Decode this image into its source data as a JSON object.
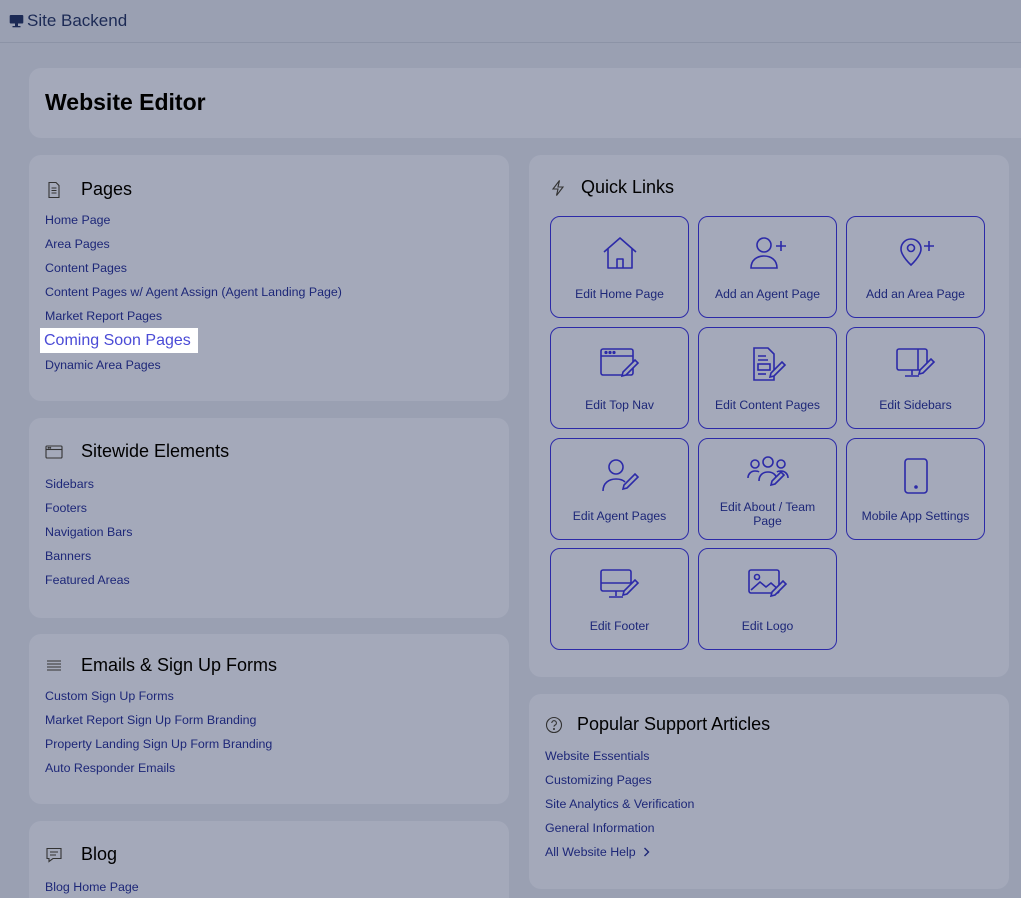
{
  "header": {
    "title": "Site Backend",
    "icon": "monitor-icon"
  },
  "editor": {
    "title": "Website Editor"
  },
  "pages": {
    "title": "Pages",
    "icon": "document-icon",
    "links": [
      "Home Page",
      "Area Pages",
      "Content Pages",
      "Content Pages w/ Agent Assign (Agent Landing Page)",
      "Market Report Pages",
      "Coming Soon Pages",
      "Dynamic Area Pages"
    ]
  },
  "sitewide": {
    "title": "Sitewide Elements",
    "icon": "browser-window-icon",
    "links": [
      "Sidebars",
      "Footers",
      "Navigation Bars",
      "Banners",
      "Featured Areas"
    ]
  },
  "emails": {
    "title": "Emails & Sign Up Forms",
    "icon": "list-icon",
    "links": [
      "Custom Sign Up Forms",
      "Market Report Sign Up Form Branding",
      "Property Landing Sign Up Form Branding",
      "Auto Responder Emails"
    ]
  },
  "blog": {
    "title": "Blog",
    "icon": "chat-bubble-icon",
    "links": [
      "Blog Home Page"
    ]
  },
  "quick_links": {
    "title": "Quick Links",
    "icon": "lightning-icon",
    "tiles": [
      {
        "label": "Edit Home Page",
        "icon": "home-icon"
      },
      {
        "label": "Add an Agent Page",
        "icon": "add-user-icon"
      },
      {
        "label": "Add an Area Page",
        "icon": "add-location-icon"
      },
      {
        "label": "Edit Top Nav",
        "icon": "edit-browser-icon"
      },
      {
        "label": "Edit Content Pages",
        "icon": "edit-document-icon"
      },
      {
        "label": "Edit Sidebars",
        "icon": "edit-monitor-icon"
      },
      {
        "label": "Edit Agent Pages",
        "icon": "edit-user-icon"
      },
      {
        "label": "Edit About / Team Page",
        "icon": "edit-team-icon"
      },
      {
        "label": "Mobile App Settings",
        "icon": "mobile-phone-icon"
      },
      {
        "label": "Edit Footer",
        "icon": "edit-footer-icon"
      },
      {
        "label": "Edit Logo",
        "icon": "edit-image-icon"
      }
    ]
  },
  "support": {
    "title": "Popular Support Articles",
    "icon": "help-circle-icon",
    "links": [
      "Website Essentials",
      "Customizing Pages",
      "Site Analytics & Verification",
      "General Information",
      "All Website Help"
    ],
    "more_icon": "chevron-right-icon"
  },
  "colors": {
    "backdrop": "#9aa0b2",
    "card": "#a4a9ba",
    "link": "#1d2778",
    "tile_border": "#2c2aa8",
    "highlight_text": "#4b4bd6"
  }
}
